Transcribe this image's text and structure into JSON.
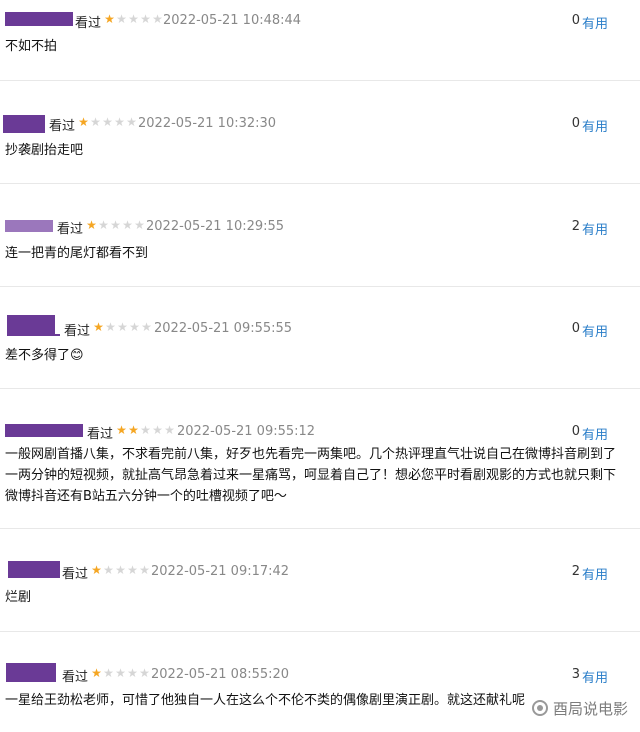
{
  "reviews": [
    {
      "seen": "看过",
      "stars": 1,
      "time": "2022-05-21 10:48:44",
      "votes": "0",
      "useful": "有用",
      "content": "不如不拍"
    },
    {
      "seen": "看过",
      "stars": 1,
      "time": "2022-05-21 10:32:30",
      "votes": "0",
      "useful": "有用",
      "content": "抄袭剧抬走吧"
    },
    {
      "seen": "看过",
      "stars": 1,
      "time": "2022-05-21 10:29:55",
      "votes": "2",
      "useful": "有用",
      "content": "连一把青的尾灯都看不到"
    },
    {
      "seen": "看过",
      "stars": 1,
      "time": "2022-05-21 09:55:55",
      "votes": "0",
      "useful": "有用",
      "content": "差不多得了😊"
    },
    {
      "seen": "看过",
      "stars": 2,
      "time": "2022-05-21 09:55:12",
      "votes": "0",
      "useful": "有用",
      "content": "一般网剧首播八集，不求看完前八集，好歹也先看完一两集吧。几个热评理直气壮说自己在微博抖音刷到了一两分钟的短视频，就扯高气昂急着过来一星痛骂，呵显着自己了！想必您平时看剧观影的方式也就只剩下微博抖音还有B站五六分钟一个的吐槽视频了吧～"
    },
    {
      "seen": "看过",
      "stars": 1,
      "time": "2022-05-21 09:17:42",
      "votes": "2",
      "useful": "有用",
      "content": "烂剧"
    },
    {
      "seen": "看过",
      "stars": 1,
      "time": "2022-05-21 08:55:20",
      "votes": "3",
      "useful": "有用",
      "content": "一星给王劲松老师，可惜了他独自一人在这么个不伦不类的偶像剧里演正剧。就这还献礼呢"
    }
  ],
  "watermark": {
    "text": "酉局说电影",
    "icon": "weibo-style-logo-icon"
  },
  "colors": {
    "accent": "#2a7ec9",
    "star_on": "#f5a623",
    "star_off": "#d6d6d6",
    "redaction": "#6a3a96"
  }
}
